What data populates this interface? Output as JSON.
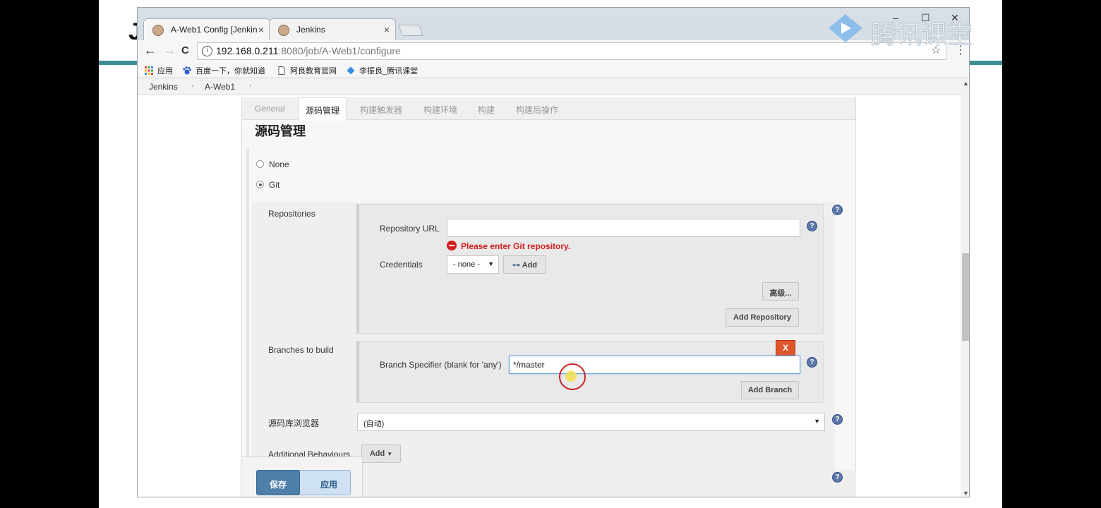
{
  "slide": {
    "title_fragment": "J"
  },
  "browser": {
    "tabs": [
      {
        "label": "A-Web1 Config [Jenkin",
        "close": "×"
      },
      {
        "label": "Jenkins",
        "close": "×"
      }
    ],
    "window_controls": {
      "minimize": "–",
      "maximize": "☐",
      "close": "✕"
    },
    "nav": {
      "back": "←",
      "forward": "→",
      "reload": "C"
    },
    "url": {
      "host": "192.168.0.211",
      "path": ":8080/job/A-Web1/configure",
      "info": "i"
    },
    "star": "☆",
    "menu": "⋮",
    "bookmarks": [
      {
        "label": "应用",
        "icon": "apps-grid-icon"
      },
      {
        "label": "百度一下，你就知道",
        "icon": "baidu-paw-icon"
      },
      {
        "label": "阿良教育官网",
        "icon": "page-icon"
      },
      {
        "label": "李振良_腾讯课堂",
        "icon": "tencent-diamond-icon"
      }
    ]
  },
  "breadcrumb": {
    "items": [
      "Jenkins",
      "A-Web1"
    ],
    "sep": "›"
  },
  "config": {
    "tabs": [
      "General",
      "源码管理",
      "构建触发器",
      "构建环境",
      "构建",
      "构建后操作"
    ],
    "active_tab": "源码管理",
    "section_title": "源码管理",
    "scm_options": [
      {
        "label": "None",
        "checked": false
      },
      {
        "label": "Git",
        "checked": true
      }
    ],
    "repositories": {
      "label": "Repositories",
      "url_label": "Repository URL",
      "url_value": "",
      "error": "Please enter Git repository.",
      "credentials_label": "Credentials",
      "credentials_value": "- none -",
      "add_label": "Add",
      "advanced_label": "高级...",
      "add_repo_label": "Add Repository"
    },
    "branches": {
      "label": "Branches to build",
      "specifier_label": "Branch Specifier (blank for 'any')",
      "specifier_value": "*/master",
      "delete_label": "X",
      "add_branch_label": "Add Branch"
    },
    "browser": {
      "label": "源码库浏览器",
      "value": "(自动)"
    },
    "additional": {
      "label": "Additional Behaviours",
      "add_label": "Add"
    },
    "help_glyph": "?"
  },
  "footer": {
    "save_label": "保存",
    "apply_label": "应用"
  },
  "watermark": {
    "text": "腾讯课堂"
  }
}
